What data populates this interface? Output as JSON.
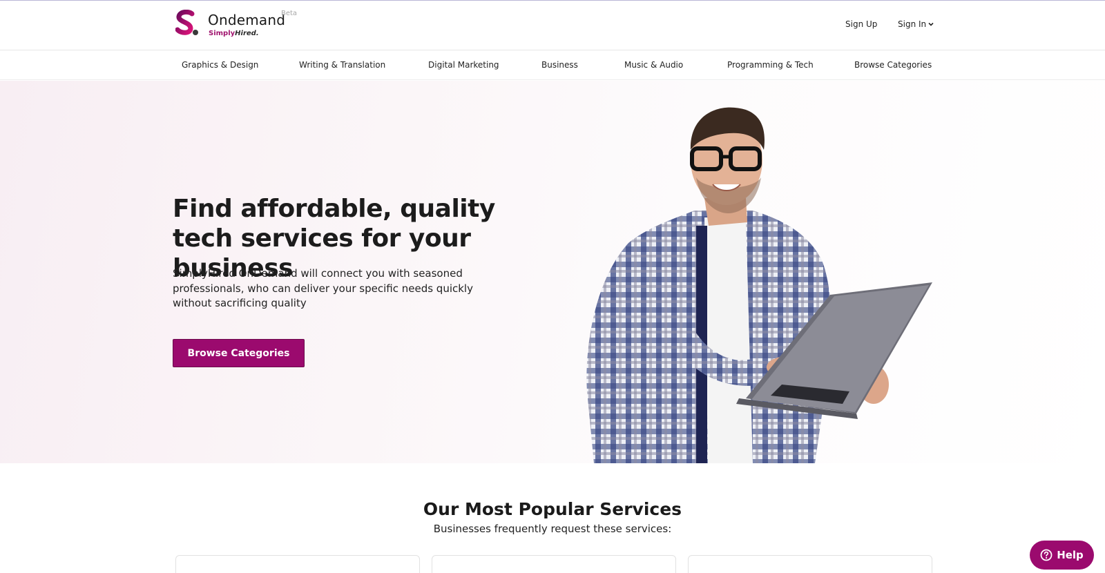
{
  "brand": {
    "name": "Ondemand",
    "badge": "Beta",
    "sub_prefix": "Simply",
    "sub_suffix": "Hired.",
    "accent_color": "#9b0a6e"
  },
  "header": {
    "sign_up": "Sign Up",
    "sign_in": "Sign In"
  },
  "nav": {
    "items": [
      "Graphics & Design",
      "Writing & Translation",
      "Digital Marketing",
      "Business",
      "Music & Audio",
      "Programming & Tech",
      "Browse Categories"
    ]
  },
  "hero": {
    "title": "Find affordable, quality tech services for your business",
    "text": "SimplyHired OnDemand will connect you with seasoned professionals, who can deliver your specific needs quickly without sacrificing quality",
    "button": "Browse Categories"
  },
  "popular": {
    "title": "Our Most Popular Services",
    "subtitle": "Businesses frequently request these services:"
  },
  "help": {
    "label": "Help"
  }
}
